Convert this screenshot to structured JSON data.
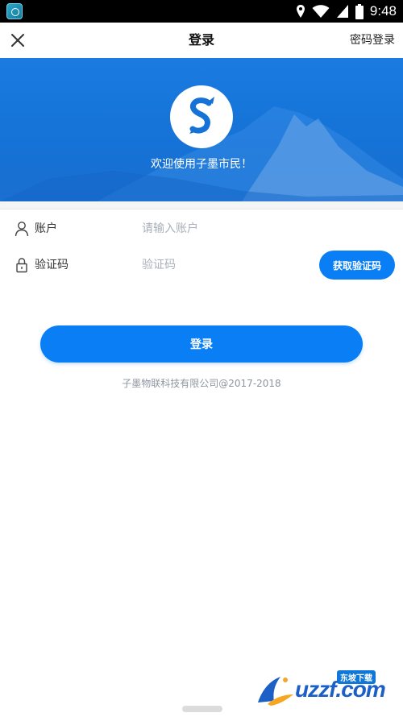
{
  "status_bar": {
    "time": "9:48",
    "icons": [
      "app-icon",
      "location-icon",
      "wifi-icon",
      "signal-icon",
      "battery-icon"
    ]
  },
  "nav": {
    "title": "登录",
    "right_link": "密码登录",
    "close_icon": "close-icon"
  },
  "banner": {
    "welcome": "欢迎使用子墨市民！",
    "logo_letter": "S"
  },
  "form": {
    "account": {
      "label": "账户",
      "placeholder": "请输入账户",
      "icon": "user-icon"
    },
    "code": {
      "label": "验证码",
      "placeholder": "验证码",
      "icon": "lock-icon",
      "button": "获取验证码"
    }
  },
  "login_button": "登录",
  "copyright": "子墨物联科技有限公司@2017-2018",
  "watermark": {
    "text": "uzzf.com",
    "tag": "东坡下载"
  },
  "colors": {
    "accent": "#0a7ff5",
    "banner": "#1572d6",
    "placeholder": "#a9b0bb"
  }
}
